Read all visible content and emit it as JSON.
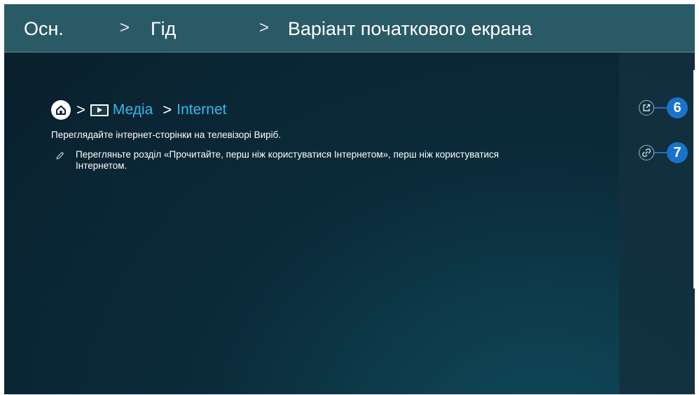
{
  "header": {
    "crumbs": [
      "Осн.",
      "Гід",
      "Варіант початкового екрана"
    ],
    "separator": ">"
  },
  "path": {
    "separator": ">",
    "items": [
      "Медіа",
      "Internet"
    ]
  },
  "content": {
    "description": "Переглядайте інтернет-сторінки на телевізорі Виріб.",
    "note": "Перегляньте розділ «Прочитайте, перш ніж користуватися Інтернетом», перш ніж користуватися Інтернетом."
  },
  "side": {
    "callouts": [
      "6",
      "7"
    ]
  },
  "icons": [
    "home-icon",
    "media-play-icon",
    "pencil-icon",
    "external-link-icon",
    "chain-link-icon"
  ],
  "colors": {
    "header_bg": "#2a5a66",
    "link": "#3ab8ea",
    "callout": "#1a72cc"
  }
}
